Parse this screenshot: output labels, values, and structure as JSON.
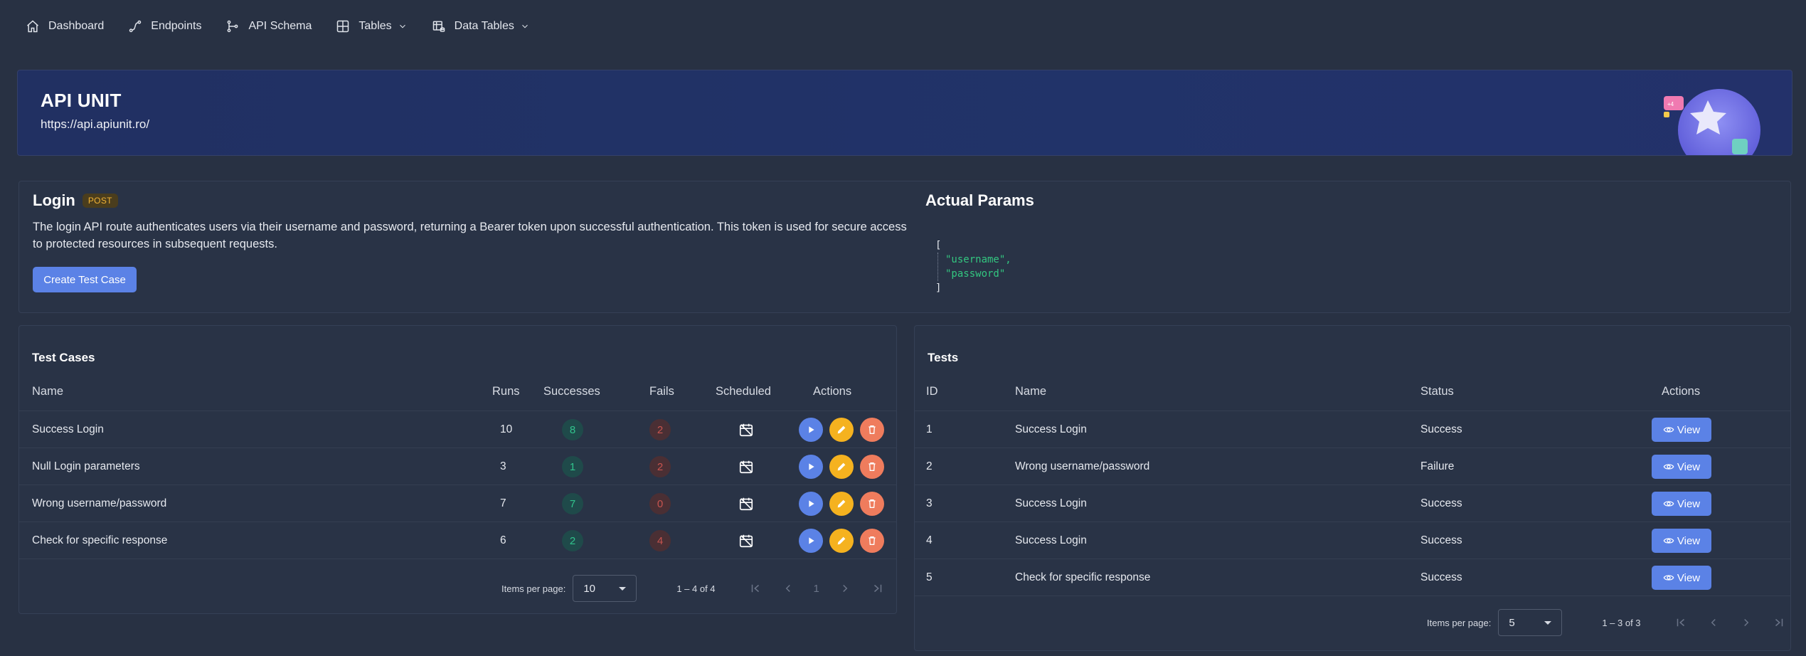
{
  "nav": {
    "items": [
      {
        "label": "Dashboard",
        "icon": "home-icon"
      },
      {
        "label": "Endpoints",
        "icon": "route-icon"
      },
      {
        "label": "API Schema",
        "icon": "schema-icon"
      },
      {
        "label": "Tables",
        "icon": "table-icon",
        "dropdown": true
      },
      {
        "label": "Data Tables",
        "icon": "data-table-icon",
        "dropdown": true
      }
    ]
  },
  "project": {
    "title": "API UNIT",
    "url": "https://api.apiunit.ro/",
    "badge_text": "+4"
  },
  "endpoint": {
    "name": "Login",
    "method": "POST",
    "description": "The login API route authenticates users via their username and password, returning a Bearer token upon successful authentication. This token is used for secure access to protected resources in subsequent requests.",
    "create_button": "Create Test Case"
  },
  "params": {
    "title": "Actual Params",
    "open": "[",
    "close": "]",
    "items": [
      "\"username\",",
      "\"password\""
    ]
  },
  "test_cases": {
    "title": "Test Cases",
    "headers": {
      "name": "Name",
      "runs": "Runs",
      "successes": "Successes",
      "fails": "Fails",
      "scheduled": "Scheduled",
      "actions": "Actions"
    },
    "rows": [
      {
        "name": "Success Login",
        "runs": "10",
        "successes": "8",
        "fails": "2"
      },
      {
        "name": "Null Login parameters",
        "runs": "3",
        "successes": "1",
        "fails": "2"
      },
      {
        "name": "Wrong username/password",
        "runs": "7",
        "successes": "7",
        "fails": "0"
      },
      {
        "name": "Check for specific response",
        "runs": "6",
        "successes": "2",
        "fails": "4"
      }
    ],
    "pager": {
      "label": "Items per page:",
      "size": "10",
      "range": "1 – 4 of 4",
      "page": "1"
    }
  },
  "tests": {
    "title": "Tests",
    "headers": {
      "id": "ID",
      "name": "Name",
      "status": "Status",
      "actions": "Actions"
    },
    "view_label": "View",
    "rows": [
      {
        "id": "1",
        "name": "Success Login",
        "status": "Success"
      },
      {
        "id": "2",
        "name": "Wrong username/password",
        "status": "Failure"
      },
      {
        "id": "3",
        "name": "Success Login",
        "status": "Success"
      },
      {
        "id": "4",
        "name": "Success Login",
        "status": "Success"
      },
      {
        "id": "5",
        "name": "Check for specific response",
        "status": "Success"
      }
    ],
    "pager": {
      "label": "Items per page:",
      "size": "5",
      "range": "1 – 3 of 3"
    }
  },
  "colors": {
    "background": "#283143",
    "hero": "#213062",
    "primary": "#5b82e6",
    "warning": "#f5b21f",
    "danger": "#ef7c5d",
    "success": "#31c38c"
  }
}
